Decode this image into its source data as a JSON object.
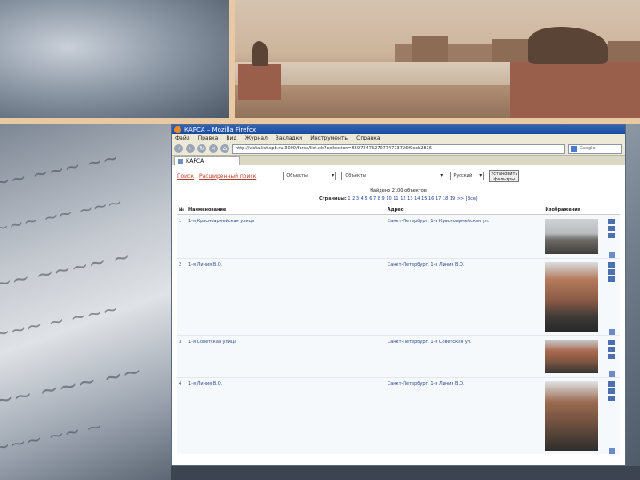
{
  "browser": {
    "window_title": "КАРСА – Mozilla Firefox",
    "menu": [
      "Файл",
      "Правка",
      "Вид",
      "Журнал",
      "Закладки",
      "Инструменты",
      "Справка"
    ],
    "url": "http://vista.list.spb.ru:3000/farsa/list.xls?collection=65972473270774773726f9ecb2816",
    "search_placeholder": "Google",
    "tab_title": "КАРСА"
  },
  "filters": {
    "search_link": "Поиск",
    "advanced_link": "Расширенный поиск",
    "select1": "Объекты",
    "select2": "Объекты",
    "select3": "Русский",
    "apply_button": "Установить фильтры"
  },
  "results": {
    "found_text": "Найдено 2100 объектов",
    "pages_prefix": "Страницы:",
    "pages_list": "1 2 3 4 5 6 7 8 9 10 11 12 13 14 15 16 17 18 19 >> [Все]",
    "columns": [
      "№",
      "Наименование",
      "Адрес",
      "Изображения"
    ]
  },
  "rows": [
    {
      "num": "1",
      "name": "1-я Красноармейская улица",
      "address": "Санкт-Петербург, 1-я Красноармейская ул."
    },
    {
      "num": "2",
      "name": "1-я Линия В.О.",
      "address": "Санкт-Петербург, 1-я Линия В.О."
    },
    {
      "num": "3",
      "name": "1-я Советская улица",
      "address": "Санкт-Петербург, 1-я Советская ул."
    },
    {
      "num": "4",
      "name": "1-я Линия В.О.",
      "address": "Санкт-Петербург, 1-я Линия В.О."
    }
  ],
  "colors": {
    "frame_accent": "#e8c9a4",
    "link": "#c03a2a",
    "titlebar": "#2e63b8"
  }
}
